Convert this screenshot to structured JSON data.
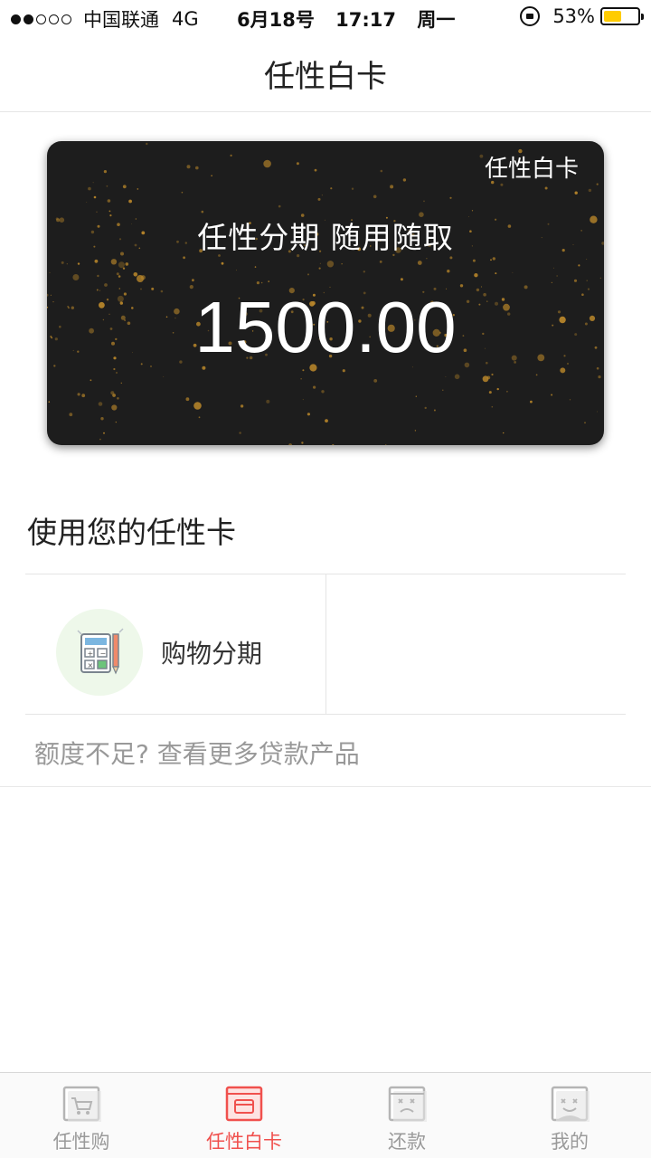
{
  "status_bar": {
    "signal_dots_filled": 2,
    "signal_dots_total": 5,
    "carrier": "中国联通",
    "network": "4G",
    "date": "6月18号",
    "time": "17:17",
    "weekday": "周一",
    "battery_percent": "53%",
    "battery_level": 0.53
  },
  "navbar": {
    "title": "任性白卡"
  },
  "card": {
    "brand": "任性白卡",
    "slogan": "任性分期  随用随取",
    "amount": "1500.00"
  },
  "section": {
    "title": "使用您的任性卡",
    "services": [
      {
        "label": "购物分期",
        "icon": "calculator-icon"
      }
    ],
    "more_link": "额度不足? 查看更多贷款产品"
  },
  "tabbar": {
    "tabs": [
      {
        "label": "任性购",
        "icon": "cart-icon",
        "active": false
      },
      {
        "label": "任性白卡",
        "icon": "card-icon",
        "active": true
      },
      {
        "label": "还款",
        "icon": "bill-icon",
        "active": false
      },
      {
        "label": "我的",
        "icon": "profile-icon",
        "active": false
      }
    ]
  },
  "colors": {
    "accent": "#f0504d",
    "card_bg": "#1d1d1d",
    "speck_gold": "#b8862a",
    "service_icon_bg": "#eef8ea",
    "battery_fill": "#ffcc00"
  }
}
